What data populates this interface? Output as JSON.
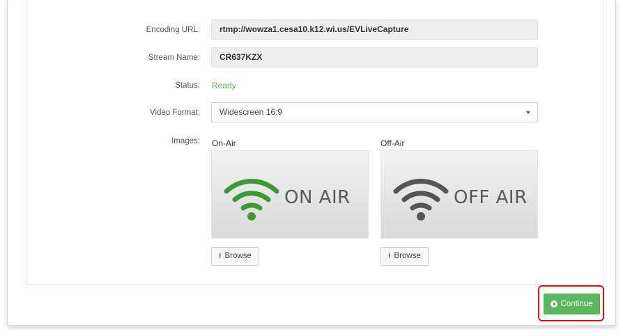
{
  "form": {
    "encoding_url": {
      "label": "Encoding URL:",
      "value": "rtmp://wowza1.cesa10.k12.wi.us/EVLiveCapture"
    },
    "stream_name": {
      "label": "Stream Name:",
      "value": "CR637KZX"
    },
    "status": {
      "label": "Status:",
      "value": "Ready",
      "color": "#5cb85c"
    },
    "video_format": {
      "label": "Video Format:",
      "value": "Widescreen 16:9"
    },
    "images_label": "Images:"
  },
  "images": {
    "on_air": {
      "title": "On-Air",
      "text": "ON AIR",
      "icon": "wifi-icon",
      "icon_color": "#3a9b35",
      "browse_label": "Browse"
    },
    "off_air": {
      "title": "Off-Air",
      "text": "OFF AIR",
      "icon": "wifi-icon",
      "icon_color": "#555555",
      "browse_label": "Browse"
    }
  },
  "actions": {
    "continue_label": "Continue",
    "continue_color": "#5cb85c",
    "highlight_color": "#e01010"
  }
}
